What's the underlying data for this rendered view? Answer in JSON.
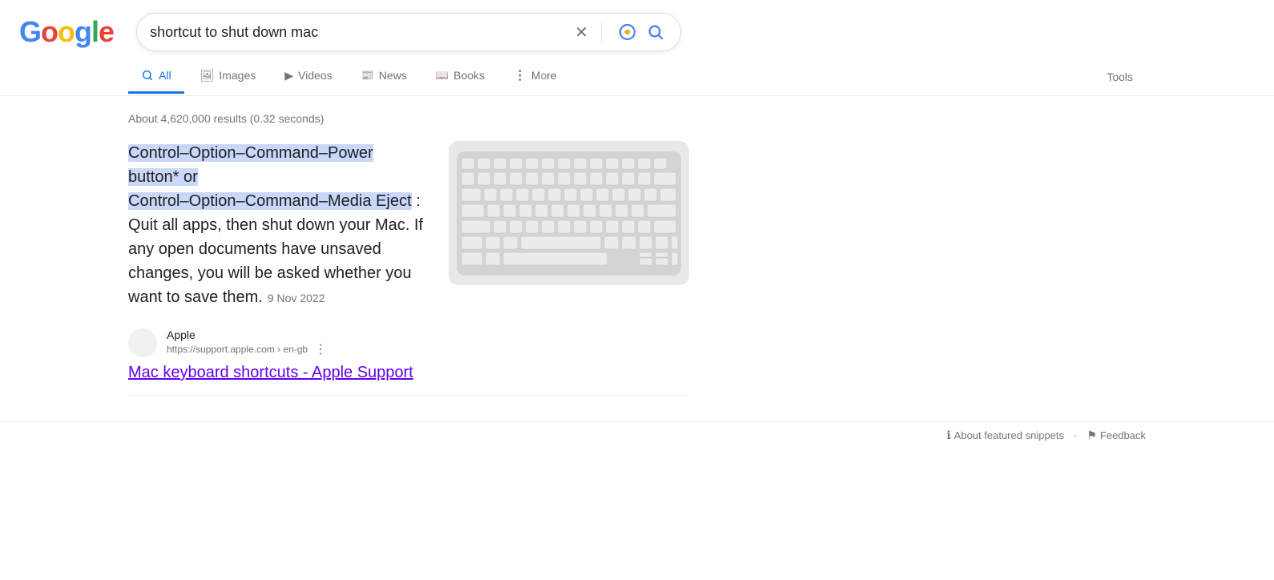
{
  "header": {
    "logo_letters": [
      {
        "char": "G",
        "color_class": "g-blue"
      },
      {
        "char": "o",
        "color_class": "g-red"
      },
      {
        "char": "o",
        "color_class": "g-yellow"
      },
      {
        "char": "g",
        "color_class": "g-blue"
      },
      {
        "char": "l",
        "color_class": "g-green"
      },
      {
        "char": "e",
        "color_class": "g-red"
      }
    ],
    "search_query": "shortcut to shut down mac"
  },
  "tabs": {
    "items": [
      {
        "id": "all",
        "label": "All",
        "icon": "🔍",
        "active": true
      },
      {
        "id": "images",
        "label": "Images",
        "icon": "🖼",
        "active": false
      },
      {
        "id": "videos",
        "label": "Videos",
        "icon": "▶",
        "active": false
      },
      {
        "id": "news",
        "label": "News",
        "icon": "📰",
        "active": false
      },
      {
        "id": "books",
        "label": "Books",
        "icon": "📖",
        "active": false
      },
      {
        "id": "more",
        "label": "More",
        "icon": "⋮",
        "active": false
      }
    ],
    "tools_label": "Tools"
  },
  "results": {
    "count_text": "About 4,620,000 results (0.32 seconds)",
    "featured_snippet": {
      "text_before_highlight": "",
      "highlight_text": "Control–Option–Command–Power button* or\nControl–Option–Command–Media Eject",
      "text_after": " : Quit all apps, then shut down your Mac. If any open documents have unsaved changes, you will be asked whether you want to save them.",
      "date": "9 Nov 2022"
    },
    "source": {
      "name": "Apple",
      "url": "https://support.apple.com › en-gb",
      "favicon_icon": ""
    },
    "result_link_text": "Mac keyboard shortcuts - Apple Support"
  },
  "bottom": {
    "featured_snippets_label": "About featured snippets",
    "feedback_label": "Feedback",
    "dot_separator": "·"
  }
}
